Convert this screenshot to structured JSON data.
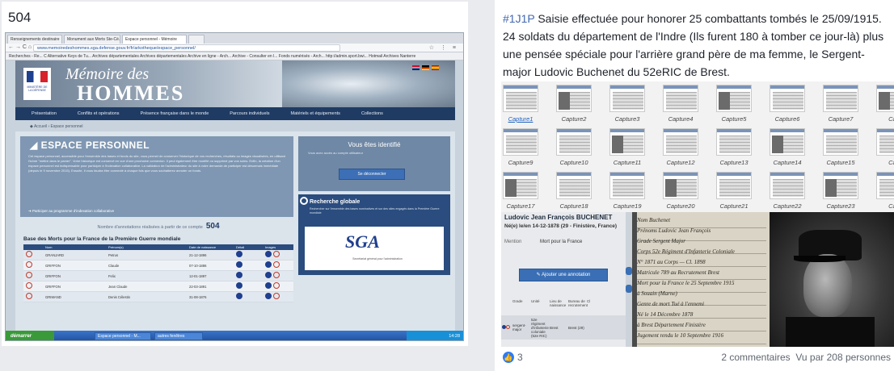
{
  "left": {
    "title": "504",
    "browser": {
      "tabs": [
        "Renseignements destinaire",
        "Monument aux Morts Ste-Cé...",
        "Espace personnel - Mémoire",
        ""
      ],
      "url": "www.memoiredeshommes.sga.defense.gouv.fr/fr/arkotheque/espace_personnel/",
      "bookmarks": "Recherches - Re... C Alternative Keys de Tu... Archives départementales  Archives départementales  Archive en ligne - Arch...  Archive - Consulter en l...  Fonds numérisés - Arch...  http://admin.sport.bwi...  Hotmail  Archives Nanterre"
    },
    "site": {
      "logo_text": "MINISTÈRE DE LA DÉFENSE",
      "brand_line1": "Mémoire des",
      "brand_line2": "HOMMES",
      "nav": [
        "Présentation",
        "Conflits et opérations",
        "Présence française dans le monde",
        "Parcours individuels",
        "Matériels et équipements",
        "Collections"
      ],
      "breadcrumb": "◆ Accueil › Espace personnel",
      "ep_title": "◢ ESPACE PERSONNEL",
      "ep_text": "Cet espace personnel, accessible pour l'ensemble des bases et fonds du site, vous permet de conserver l'historique de vos recherches, résultats ou images visualisées, en utilisant l'icône \"mettre dans le panier\". Votre historique est conservé en vue d'une prochaine connexion. Il peut également être modifié ou supprimé par vos soins. Enfin, la création d'un espace personnel est indispensable pour participer à l'indexation collaborative. La validation de l'administrateur du site à votre demande de participer est désormais immédiate (depuis le 9 novembre 2015). Ensuite, il vous faudra être connecté à chaque fois que vous souhaiterez annoter un fonds.",
      "ep_link": "➜ Participer au programme d'indexation collaborative",
      "identified_title": "Vous êtes identifié",
      "identified_sub": "Vous avez accès au compte utilisateur",
      "logout_label": "Se déconnecter",
      "global_title": "Recherche globale",
      "global_text": "Rechercher sur l'ensemble des bases nominatives et sur des sites engagés dans la Première Guerre mondiale",
      "sga_logo": "SGA",
      "sga_sub": "Secrétariat général pour l'administration",
      "counter_label": "Nombre d'annotations réalisées à partir de ce compte",
      "counter_value": "504",
      "table_title": "Base des Morts pour la France de la Première Guerre mondiale",
      "table_headers": [
        "",
        "Nom",
        "Prénom(s)",
        "Date de naissance",
        "Détail",
        "Images"
      ],
      "rows": [
        {
          "nom": "GRANJARD",
          "prenom": "Petrus",
          "date": "21-12-1896"
        },
        {
          "nom": "GRIFFON",
          "prenom": "Claude",
          "date": "07-10-1886"
        },
        {
          "nom": "GRIFFON",
          "prenom": "Felix",
          "date": "12-01-1897"
        },
        {
          "nom": "GRIFFON",
          "prenom": "Jean Claude",
          "date": "22-03-1891"
        },
        {
          "nom": "GRIMAND",
          "prenom": "Denis Célestin",
          "date": "31-08-1876"
        }
      ]
    },
    "taskbar": {
      "start": "démarrer",
      "tasks": [
        "Espace personnel - M...",
        "autres fenêtres"
      ],
      "clock": "14:28"
    }
  },
  "right": {
    "post": {
      "hashtag": "#1J1P",
      "text": " Saisie effectuée pour honorer 25 combattants tombés le 25/09/1915. 24 soldats du département de l'Indre (Ils furent 180 à tomber ce jour-là) plus une pensée spéciale pour l'arrière grand père de ma femme, le Sergent-major Ludovic Buchenet du 52eRIC de Brest."
    },
    "captures": [
      "Capture1",
      "Capture2",
      "Capture3",
      "Capture4",
      "Capture5",
      "Capture6",
      "Capture7",
      "Cap",
      "Capture9",
      "Capture10",
      "Capture11",
      "Capture12",
      "Capture13",
      "Capture14",
      "Capture15",
      "Cap",
      "Capture17",
      "Capture18",
      "Capture19",
      "Capture20",
      "Capture21",
      "Capture22",
      "Capture23",
      "Cap"
    ],
    "fiche": {
      "name": "Ludovic Jean François BUCHENET",
      "birth": "Né(e) le/en 14-12-1878 (29 - Finistère, France)",
      "mention_label": "Mention",
      "mention_value": "Mort pour la France",
      "annot_button": "✎ Ajouter une annotation",
      "headers": [
        "Grade",
        "Unité",
        "Lieu de naissance",
        "Bureau de recrutement",
        "Cl"
      ],
      "row": [
        "sergent-major",
        "52e régiment d'infanterie coloniale (52e RIC)",
        "Brest",
        "Brest (29)",
        ""
      ]
    },
    "manuscript": [
      "Nom  Buchenet",
      "Prénoms  Ludovic Jean François",
      "Grade  Sergent Major",
      "Corps  52e Régiment d'Infanterie Coloniale",
      "N° 1871 au Corps — Cl. 1898",
      "Matricule  789 au Recrutement  Brest",
      "Mort pour la France le 25 Septembre 1915",
      "à  Souain (Marne)",
      "Genre de mort  Tué à l'ennemi",
      "Né le 14 Décembre 1878",
      "à  Brest   Département  Finistère",
      "Jugement rendu le  10 Septembre 1916"
    ],
    "footer": {
      "like_count": "3",
      "comments": "2 commentaires",
      "views": "Vu par 208 personnes"
    }
  }
}
